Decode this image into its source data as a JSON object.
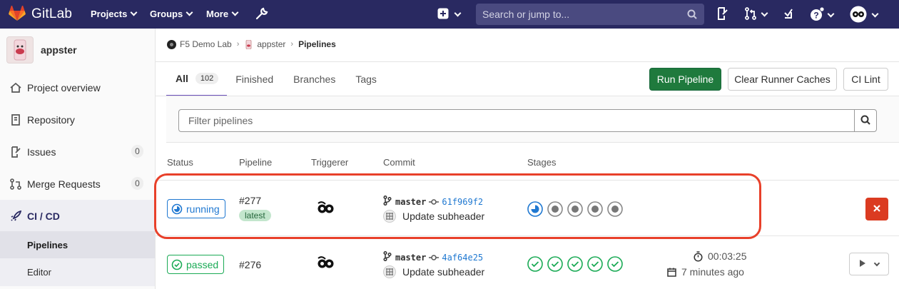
{
  "nav": {
    "brand": "GitLab",
    "projects": "Projects",
    "groups": "Groups",
    "more": "More",
    "search_placeholder": "Search or jump to..."
  },
  "sidebar": {
    "project_name": "appster",
    "items": [
      {
        "label": "Project overview",
        "icon": "home-icon"
      },
      {
        "label": "Repository",
        "icon": "repository-icon"
      },
      {
        "label": "Issues",
        "icon": "issues-icon",
        "count": "0"
      },
      {
        "label": "Merge Requests",
        "icon": "merge-request-icon",
        "count": "0"
      },
      {
        "label": "CI / CD",
        "icon": "rocket-icon"
      }
    ],
    "subitems": [
      {
        "label": "Pipelines"
      },
      {
        "label": "Editor"
      }
    ]
  },
  "breadcrumb": {
    "group": "F5 Demo Lab",
    "project": "appster",
    "current": "Pipelines"
  },
  "tabs": {
    "all": "All",
    "all_count": "102",
    "finished": "Finished",
    "branches": "Branches",
    "tags": "Tags"
  },
  "buttons": {
    "run_pipeline": "Run Pipeline",
    "clear_runner_caches": "Clear Runner Caches",
    "ci_lint": "CI Lint"
  },
  "filter": {
    "placeholder": "Filter pipelines"
  },
  "table": {
    "headers": [
      "Status",
      "Pipeline",
      "Triggerer",
      "Commit",
      "Stages"
    ],
    "rows": [
      {
        "status": "running",
        "pipeline": "#277",
        "tag": "latest",
        "branch": "master",
        "sha": "61f969f2",
        "commit_title": "Update subheader",
        "stages": [
          "running",
          "created",
          "created",
          "created",
          "created"
        ]
      },
      {
        "status": "passed",
        "pipeline": "#276",
        "branch": "master",
        "sha": "4af64e25",
        "commit_title": "Update subheader",
        "stages": [
          "success",
          "success",
          "success",
          "success",
          "success"
        ],
        "duration": "00:03:25",
        "finished": "7 minutes ago"
      }
    ]
  },
  "colors": {
    "navbar": "#292961",
    "running": "#1f78d1",
    "passed": "#1aaa55",
    "run_button": "#1f7a3d",
    "cancel_button": "#db3b21",
    "highlight": "#e8402a"
  }
}
